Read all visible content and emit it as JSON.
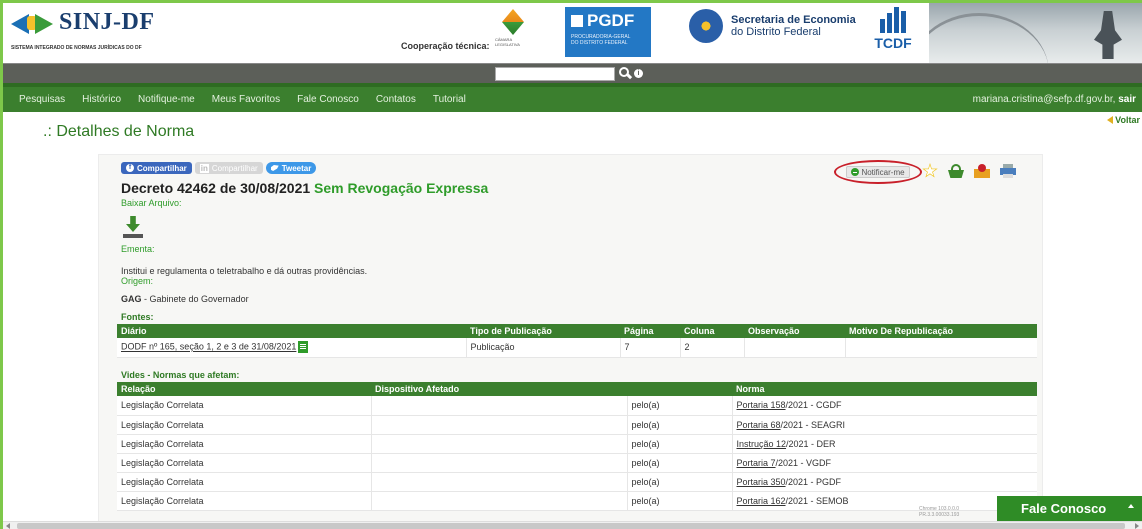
{
  "header": {
    "logo_title": "SINJ-DF",
    "logo_subtitle": "SISTEMA INTEGRADO DE NORMAS JURÍDICAS DO DF",
    "cooperacao": "Cooperação técnica:",
    "camara_label": "CÂMARA LEGISLATIVA",
    "pgdf_title": "PGDF",
    "pgdf_sub1": "PROCURADORIA-GERAL",
    "pgdf_sub2": "DO DISTRITO FEDERAL",
    "sececo_line1": "Secretaria de Economia",
    "sececo_line2": "do Distrito Federal",
    "tcdf": "TCDF"
  },
  "search": {
    "placeholder": "",
    "value": "",
    "info_icon": "i"
  },
  "nav": {
    "items": [
      "Pesquisas",
      "Histórico",
      "Notifique-me",
      "Meus Favoritos",
      "Fale Conosco",
      "Contatos",
      "Tutorial"
    ],
    "user_email": "mariana.cristina@sefp.df.gov.br,",
    "logout": "sair"
  },
  "page": {
    "title": ".: Detalhes de Norma",
    "voltar": "Voltar"
  },
  "share": {
    "facebook": "Compartilhar",
    "facebook_icon": "f",
    "linkedin": "Compartilhar",
    "linkedin_icon": "in",
    "twitter": "Tweetar"
  },
  "norma": {
    "title": "Decreto 42462 de 30/08/2021",
    "status": "Sem Revogação Expressa",
    "baixar": "Baixar Arquivo:",
    "ementa_label": "Ementa:",
    "ementa": "Institui e regulamenta o teletrabalho e dá outras providências.",
    "origem_label": "Origem:",
    "origem_code": "GAG",
    "origem_name": " - Gabinete do Governador",
    "notificar": "Notificar-me"
  },
  "fontes": {
    "label": "Fontes:",
    "headers": [
      "Diário",
      "Tipo de Publicação",
      "Página",
      "Coluna",
      "Observação",
      "Motivo De Republicação"
    ],
    "rows": [
      [
        "DODF nº 165, seção 1, 2 e 3 de 31/08/2021",
        "Publicação",
        "7",
        "2",
        "",
        ""
      ]
    ]
  },
  "vides": {
    "label": "Vides - Normas que afetam:",
    "headers": [
      "Relação",
      "Dispositivo Afetado",
      "",
      "Norma"
    ],
    "rows": [
      {
        "relacao": "Legislação Correlata",
        "disp": "",
        "pelo": "pelo(a)",
        "norma_link": "Portaria 158",
        "norma_rest": "/2021 - CGDF"
      },
      {
        "relacao": "Legislação Correlata",
        "disp": "",
        "pelo": "pelo(a)",
        "norma_link": "Portaria 68",
        "norma_rest": "/2021 - SEAGRI"
      },
      {
        "relacao": "Legislação Correlata",
        "disp": "",
        "pelo": "pelo(a)",
        "norma_link": "Instrução 12",
        "norma_rest": "/2021 - DER"
      },
      {
        "relacao": "Legislação Correlata",
        "disp": "",
        "pelo": "pelo(a)",
        "norma_link": "Portaria 7",
        "norma_rest": "/2021 - VGDF"
      },
      {
        "relacao": "Legislação Correlata",
        "disp": "",
        "pelo": "pelo(a)",
        "norma_link": "Portaria 350",
        "norma_rest": "/2021 - PGDF"
      },
      {
        "relacao": "Legislação Correlata",
        "disp": "",
        "pelo": "pelo(a)",
        "norma_link": "Portaria 162",
        "norma_rest": "/2021 - SEMOB"
      }
    ]
  },
  "footer": {
    "version1": "Chrome 103.0.0.0",
    "version2": "PR.3.3.00033.193",
    "fale": "Fale Conosco"
  },
  "colors": {
    "green": "#3b7f2e",
    "accent": "#2f9c2a",
    "highlight": "#c8202a"
  }
}
